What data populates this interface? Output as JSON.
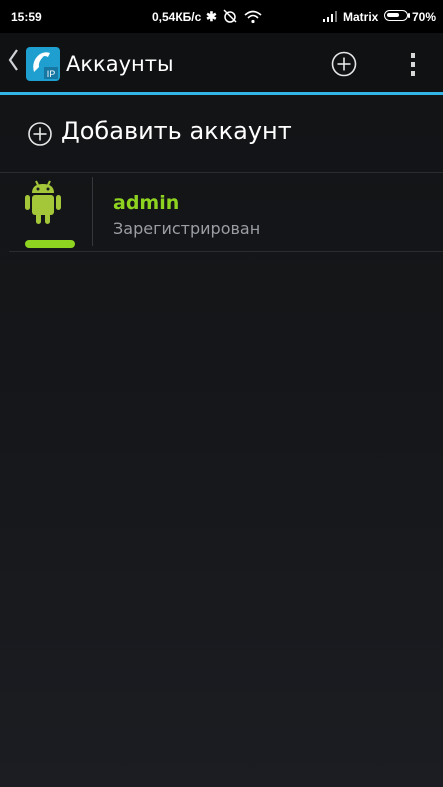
{
  "status_bar": {
    "time": "15:59",
    "network_speed": "0,54КБ/с",
    "carrier": "Matrix",
    "battery_percent": "70%",
    "battery_level": 0.7
  },
  "action_bar": {
    "title": "Аккаунты",
    "app_icon_text": "IP",
    "accent_color": "#33b5e5"
  },
  "add_account": {
    "label": "Добавить аккаунт"
  },
  "accounts": [
    {
      "name": "admin",
      "status": "Зарегистрирован",
      "status_color": "#8fd321",
      "avatar_icon": "android-icon"
    }
  ],
  "icons": {
    "back": "chevron-left-icon",
    "add": "plus-circle-icon",
    "overflow": "overflow-menu-icon",
    "bluetooth": "bluetooth-icon",
    "alarm": "alarm-off-icon",
    "wifi": "wifi-icon",
    "signal": "signal-icon",
    "battery": "battery-icon"
  }
}
